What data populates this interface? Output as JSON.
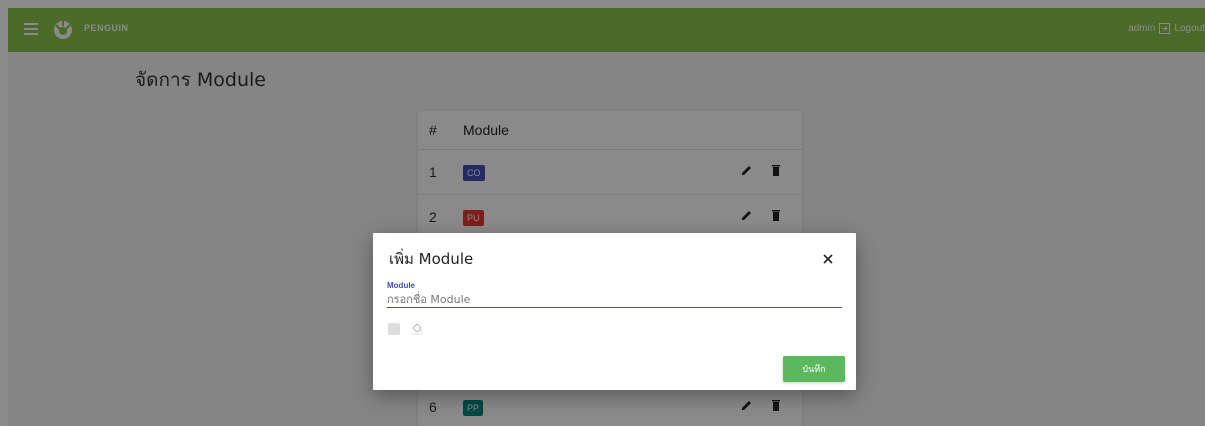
{
  "topbar": {
    "brand": "PENGUIN",
    "user": "admin",
    "logout_label": "Logout",
    "color": "#8bc34a"
  },
  "page": {
    "title": "จัดการ Module"
  },
  "table": {
    "headers": [
      "#",
      "Module"
    ],
    "rows": [
      {
        "num": "1",
        "module": "CO",
        "color": "#3f51b5"
      },
      {
        "num": "2",
        "module": "PU",
        "color": "#e53935"
      },
      {
        "num": "6",
        "module": "PP",
        "color": "#00897b"
      }
    ]
  },
  "modal": {
    "title": "เพิ่ม Module",
    "field_label": "Module",
    "field_placeholder": "กรอกชื่อ Module",
    "field_value": "",
    "save_label": "บันทึก",
    "save_color": "#5cb85c"
  },
  "icons": {
    "menu": "menu-icon",
    "logo": "penguin-logo-icon",
    "logout": "logout-icon",
    "edit": "pencil-icon",
    "delete": "trash-icon",
    "close": "close-icon",
    "fill": "paint-bucket-icon"
  }
}
